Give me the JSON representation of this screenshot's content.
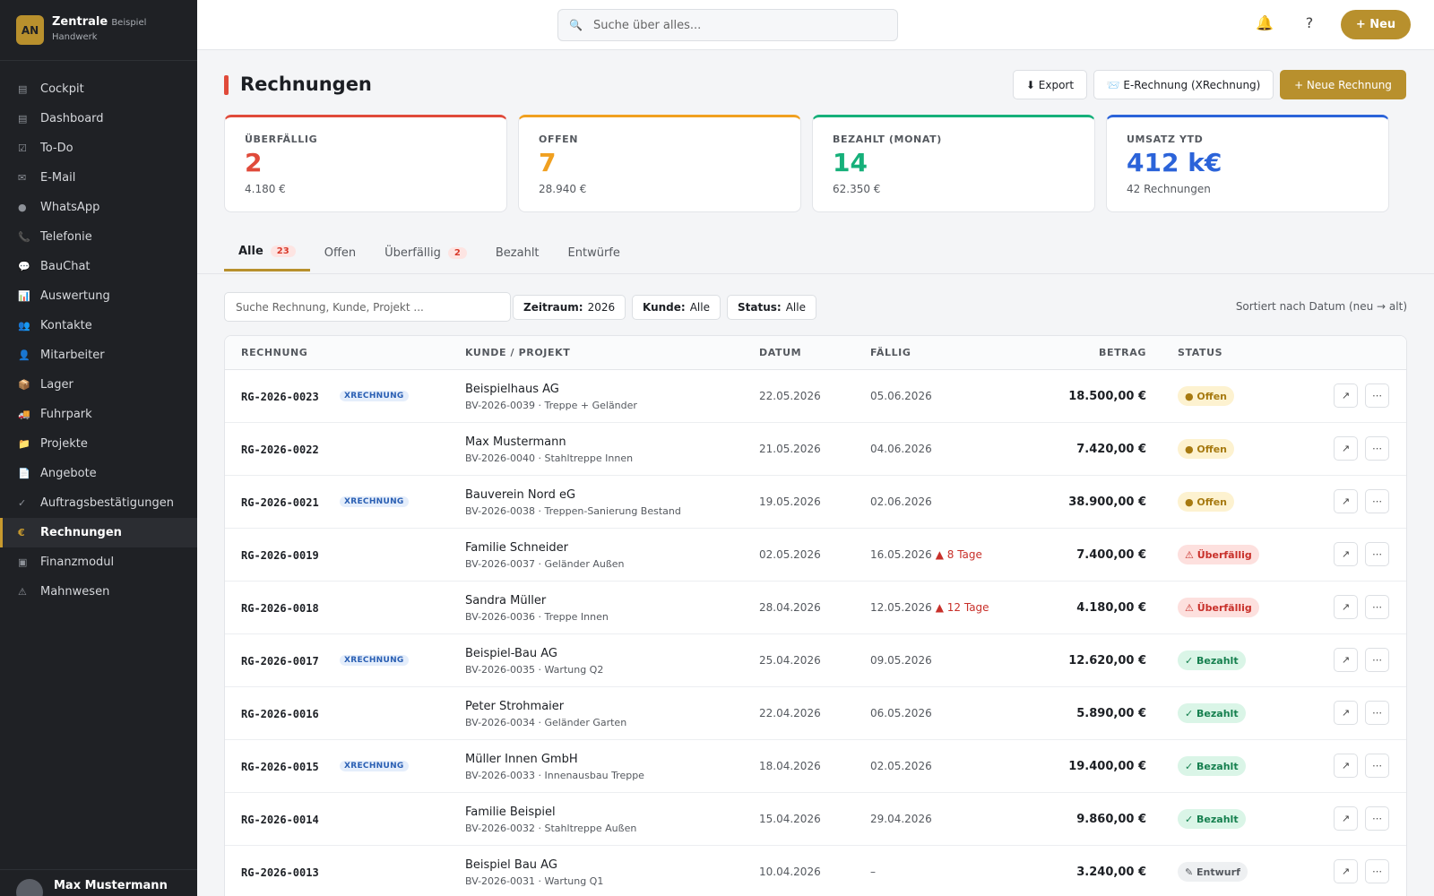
{
  "brand": {
    "logo": "AN",
    "name": "Zentrale",
    "sub1": "Beispiel",
    "sub2": "Handwerk"
  },
  "sidebar": {
    "items": [
      {
        "label": "Cockpit",
        "icon": "▤"
      },
      {
        "label": "Dashboard",
        "icon": "▤"
      },
      {
        "label": "To-Do",
        "icon": "☑"
      },
      {
        "label": "E-Mail",
        "icon": "✉"
      },
      {
        "label": "WhatsApp",
        "icon": "●"
      },
      {
        "label": "Telefonie",
        "icon": "📞"
      },
      {
        "label": "BauChat",
        "icon": "💬"
      },
      {
        "label": "Auswertung",
        "icon": "📊"
      },
      {
        "label": "Kontakte",
        "icon": "👥"
      },
      {
        "label": "Mitarbeiter",
        "icon": "👤"
      },
      {
        "label": "Lager",
        "icon": "📦"
      },
      {
        "label": "Fuhrpark",
        "icon": "🚚"
      },
      {
        "label": "Projekte",
        "icon": "📁"
      },
      {
        "label": "Angebote",
        "icon": "📄"
      },
      {
        "label": "Auftragsbestätigungen",
        "icon": "✓"
      },
      {
        "label": "Rechnungen",
        "icon": "€"
      },
      {
        "label": "Finanzmodul",
        "icon": "▣"
      },
      {
        "label": "Mahnwesen",
        "icon": "⚠"
      }
    ],
    "active_index": 15,
    "user_name": "Max Mustermann"
  },
  "topbar": {
    "search_placeholder": "Suche über alles...",
    "search_icon": "🔍",
    "bell_icon": "🔔",
    "help_icon": "?",
    "new_button": "+ Neu"
  },
  "page": {
    "title": "Rechnungen",
    "export_button": "⬇ Export",
    "erechnung_button": "📨 E-Rechnung (XRechnung)",
    "new_invoice_button": "+ Neue Rechnung"
  },
  "kpis": [
    {
      "label": "ÜBERFÄLLIG",
      "value": "2",
      "sub": "4.180 €",
      "color": "#e04a3a"
    },
    {
      "label": "OFFEN",
      "value": "7",
      "sub": "28.940 €",
      "color": "#f0a020"
    },
    {
      "label": "BEZAHLT (MONAT)",
      "value": "14",
      "sub": "62.350 €",
      "color": "#16b07a"
    },
    {
      "label": "UMSATZ YTD",
      "value": "412 k€",
      "sub": "42 Rechnungen",
      "color": "#2b63d9"
    }
  ],
  "tabs": [
    {
      "label": "Alle",
      "badge": "23"
    },
    {
      "label": "Offen",
      "badge": ""
    },
    {
      "label": "Überfällig",
      "badge": "2"
    },
    {
      "label": "Bezahlt",
      "badge": ""
    },
    {
      "label": "Entwürfe",
      "badge": ""
    }
  ],
  "filters": {
    "search_placeholder": "Suche Rechnung, Kunde, Projekt ...",
    "zeitraum_label": "Zeitraum:",
    "zeitraum_value": "2026",
    "kunde_label": "Kunde:",
    "kunde_value": "Alle",
    "status_label": "Status:",
    "status_value": "Alle",
    "sort": "Sortiert nach Datum (neu → alt)"
  },
  "table": {
    "headers": {
      "rechnung": "RECHNUNG",
      "kunde": "KUNDE / PROJEKT",
      "datum": "DATUM",
      "faellig": "FÄLLIG",
      "betrag": "BETRAG",
      "status": "STATUS"
    },
    "open_icon": "↗",
    "more_icon": "⋯",
    "rows": [
      {
        "nr": "RG-2026-0023",
        "x": "XRECHNUNG",
        "kunde": "Beispielhaus AG",
        "projekt": "BV-2026-0039 · Treppe + Geländer",
        "datum": "22.05.2026",
        "faellig": "05.06.2026",
        "over": "",
        "betrag": "18.500,00 €",
        "status": "● Offen",
        "st": "offen"
      },
      {
        "nr": "RG-2026-0022",
        "x": "",
        "kunde": "Max Mustermann",
        "projekt": "BV-2026-0040 · Stahltreppe Innen",
        "datum": "21.05.2026",
        "faellig": "04.06.2026",
        "over": "",
        "betrag": "7.420,00 €",
        "status": "● Offen",
        "st": "offen"
      },
      {
        "nr": "RG-2026-0021",
        "x": "XRECHNUNG",
        "kunde": "Bauverein Nord eG",
        "projekt": "BV-2026-0038 · Treppen-Sanierung Bestand",
        "datum": "19.05.2026",
        "faellig": "02.06.2026",
        "over": "",
        "betrag": "38.900,00 €",
        "status": "● Offen",
        "st": "offen"
      },
      {
        "nr": "RG-2026-0019",
        "x": "",
        "kunde": "Familie Schneider",
        "projekt": "BV-2026-0037 · Geländer Außen",
        "datum": "02.05.2026",
        "faellig": "16.05.2026",
        "over": "▲ 8 Tage",
        "betrag": "7.400,00 €",
        "status": "⚠ Überfällig",
        "st": "ueber"
      },
      {
        "nr": "RG-2026-0018",
        "x": "",
        "kunde": "Sandra Müller",
        "projekt": "BV-2026-0036 · Treppe Innen",
        "datum": "28.04.2026",
        "faellig": "12.05.2026",
        "over": "▲ 12 Tage",
        "betrag": "4.180,00 €",
        "status": "⚠ Überfällig",
        "st": "ueber"
      },
      {
        "nr": "RG-2026-0017",
        "x": "XRECHNUNG",
        "kunde": "Beispiel-Bau AG",
        "projekt": "BV-2026-0035 · Wartung Q2",
        "datum": "25.04.2026",
        "faellig": "09.05.2026",
        "over": "",
        "betrag": "12.620,00 €",
        "status": "✓ Bezahlt",
        "st": "bezahlt"
      },
      {
        "nr": "RG-2026-0016",
        "x": "",
        "kunde": "Peter Strohmaier",
        "projekt": "BV-2026-0034 · Geländer Garten",
        "datum": "22.04.2026",
        "faellig": "06.05.2026",
        "over": "",
        "betrag": "5.890,00 €",
        "status": "✓ Bezahlt",
        "st": "bezahlt"
      },
      {
        "nr": "RG-2026-0015",
        "x": "XRECHNUNG",
        "kunde": "Müller Innen GmbH",
        "projekt": "BV-2026-0033 · Innenausbau Treppe",
        "datum": "18.04.2026",
        "faellig": "02.05.2026",
        "over": "",
        "betrag": "19.400,00 €",
        "status": "✓ Bezahlt",
        "st": "bezahlt"
      },
      {
        "nr": "RG-2026-0014",
        "x": "",
        "kunde": "Familie Beispiel",
        "projekt": "BV-2026-0032 · Stahltreppe Außen",
        "datum": "15.04.2026",
        "faellig": "29.04.2026",
        "over": "",
        "betrag": "9.860,00 €",
        "status": "✓ Bezahlt",
        "st": "bezahlt"
      },
      {
        "nr": "RG-2026-0013",
        "x": "",
        "kunde": "Beispiel Bau AG",
        "projekt": "BV-2026-0031 · Wartung Q1",
        "datum": "10.04.2026",
        "faellig": "–",
        "over": "",
        "betrag": "3.240,00 €",
        "status": "✎ Entwurf",
        "st": "entwurf"
      }
    ]
  }
}
